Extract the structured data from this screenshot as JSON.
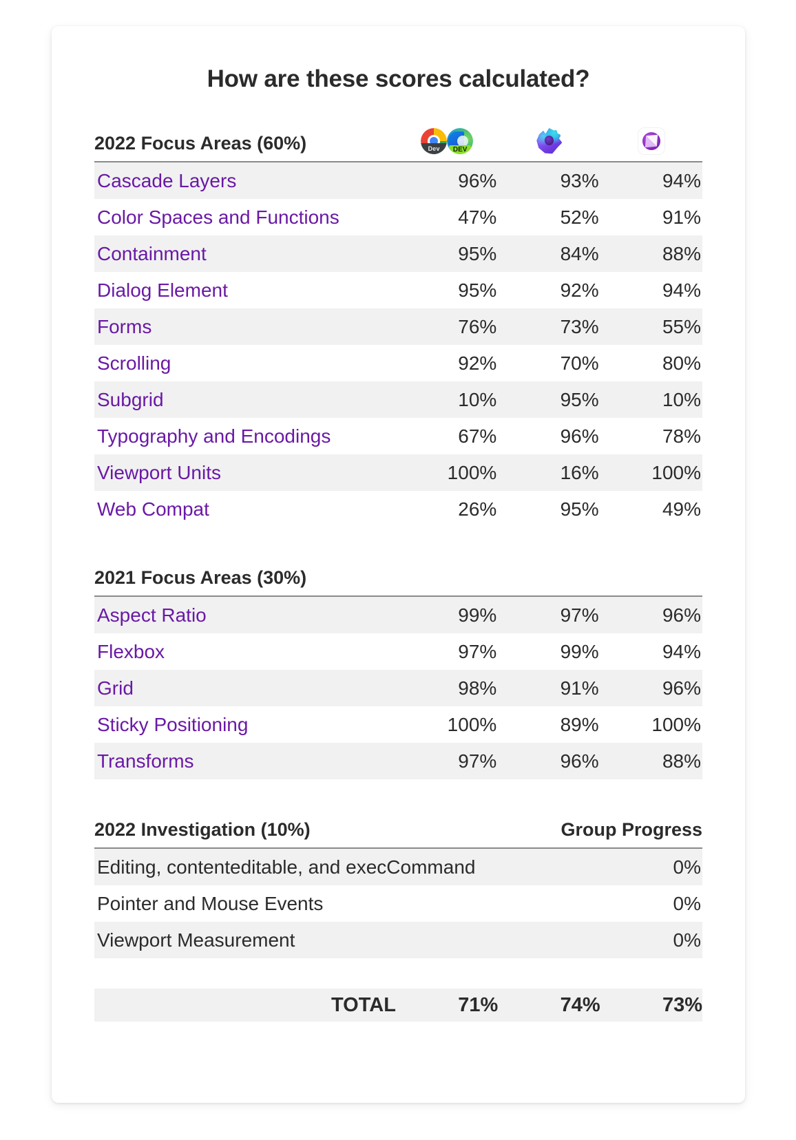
{
  "title": "How are these scores calculated?",
  "browsers": [
    {
      "name": "Chrome Dev / Edge Dev",
      "icons": [
        "chrome-dev-icon",
        "edge-dev-icon"
      ],
      "badge": "Dev",
      "badge2": "DEV"
    },
    {
      "name": "Firefox",
      "icons": [
        "firefox-icon"
      ]
    },
    {
      "name": "Safari Technology Preview",
      "icons": [
        "safari-technology-preview-icon"
      ]
    }
  ],
  "sections": [
    {
      "heading": "2022 Focus Areas (60%)",
      "right_heading": "",
      "rows": [
        {
          "label": "Cascade Layers",
          "link": true,
          "values": [
            "96%",
            "93%",
            "94%"
          ]
        },
        {
          "label": "Color Spaces and Functions",
          "link": true,
          "values": [
            "47%",
            "52%",
            "91%"
          ]
        },
        {
          "label": "Containment",
          "link": true,
          "values": [
            "95%",
            "84%",
            "88%"
          ]
        },
        {
          "label": "Dialog Element",
          "link": true,
          "values": [
            "95%",
            "92%",
            "94%"
          ]
        },
        {
          "label": "Forms",
          "link": true,
          "values": [
            "76%",
            "73%",
            "55%"
          ]
        },
        {
          "label": "Scrolling",
          "link": true,
          "values": [
            "92%",
            "70%",
            "80%"
          ]
        },
        {
          "label": "Subgrid",
          "link": true,
          "values": [
            "10%",
            "95%",
            "10%"
          ]
        },
        {
          "label": "Typography and Encodings",
          "link": true,
          "values": [
            "67%",
            "96%",
            "78%"
          ]
        },
        {
          "label": "Viewport Units",
          "link": true,
          "values": [
            "100%",
            "16%",
            "100%"
          ]
        },
        {
          "label": "Web Compat",
          "link": true,
          "values": [
            "26%",
            "95%",
            "49%"
          ]
        }
      ]
    },
    {
      "heading": "2021 Focus Areas (30%)",
      "right_heading": "",
      "rows": [
        {
          "label": "Aspect Ratio",
          "link": true,
          "values": [
            "99%",
            "97%",
            "96%"
          ]
        },
        {
          "label": "Flexbox",
          "link": true,
          "values": [
            "97%",
            "99%",
            "94%"
          ]
        },
        {
          "label": "Grid",
          "link": true,
          "values": [
            "98%",
            "91%",
            "96%"
          ]
        },
        {
          "label": "Sticky Positioning",
          "link": true,
          "values": [
            "100%",
            "89%",
            "100%"
          ]
        },
        {
          "label": "Transforms",
          "link": true,
          "values": [
            "97%",
            "96%",
            "88%"
          ]
        }
      ]
    },
    {
      "heading": "2022 Investigation (10%)",
      "right_heading": "Group Progress",
      "rows": [
        {
          "label": "Editing, contenteditable, and execCommand",
          "link": false,
          "values": [
            "0%"
          ]
        },
        {
          "label": "Pointer and Mouse Events",
          "link": false,
          "values": [
            "0%"
          ]
        },
        {
          "label": "Viewport Measurement",
          "link": false,
          "values": [
            "0%"
          ]
        }
      ]
    }
  ],
  "total": {
    "label": "TOTAL",
    "values": [
      "71%",
      "74%",
      "73%"
    ]
  },
  "colors": {
    "link": "#6a19a6",
    "text": "#2b2b2b",
    "row_alt": "#f1f1f1",
    "rule": "#8a8a8a",
    "card": "#ffffff"
  }
}
